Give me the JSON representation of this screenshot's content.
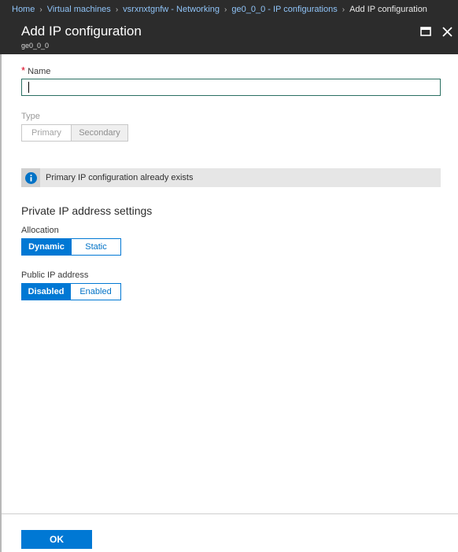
{
  "breadcrumb": {
    "items": [
      {
        "label": "Home"
      },
      {
        "label": "Virtual machines"
      },
      {
        "label": "vsrxnxtgnfw - Networking"
      },
      {
        "label": "ge0_0_0 - IP configurations"
      }
    ],
    "separator": "›",
    "current": "Add IP configuration"
  },
  "blade": {
    "title": "Add IP configuration",
    "subtitle": "ge0_0_0",
    "maximize_icon": "maximize-icon",
    "close_icon": "close-icon"
  },
  "form": {
    "name": {
      "required_marker": "*",
      "label": "Name",
      "value": ""
    },
    "type": {
      "label": "Type",
      "options": [
        "Primary",
        "Secondary"
      ],
      "selected": "Secondary",
      "disabled": true
    },
    "info": {
      "icon": "info-icon",
      "message": "Primary IP configuration already exists"
    },
    "private_ip_section": {
      "title": "Private IP address settings",
      "allocation": {
        "label": "Allocation",
        "options": [
          "Dynamic",
          "Static"
        ],
        "selected": "Dynamic"
      }
    },
    "public_ip": {
      "label": "Public IP address",
      "options": [
        "Disabled",
        "Enabled"
      ],
      "selected": "Disabled"
    }
  },
  "footer": {
    "ok_label": "OK"
  },
  "colors": {
    "accent": "#0078d4",
    "header_bg": "#2c2c2c",
    "breadcrumb_link": "#8fc3f7",
    "input_border": "#2a6f62",
    "required": "#d9001b",
    "info_bg": "#e6e6e6"
  }
}
